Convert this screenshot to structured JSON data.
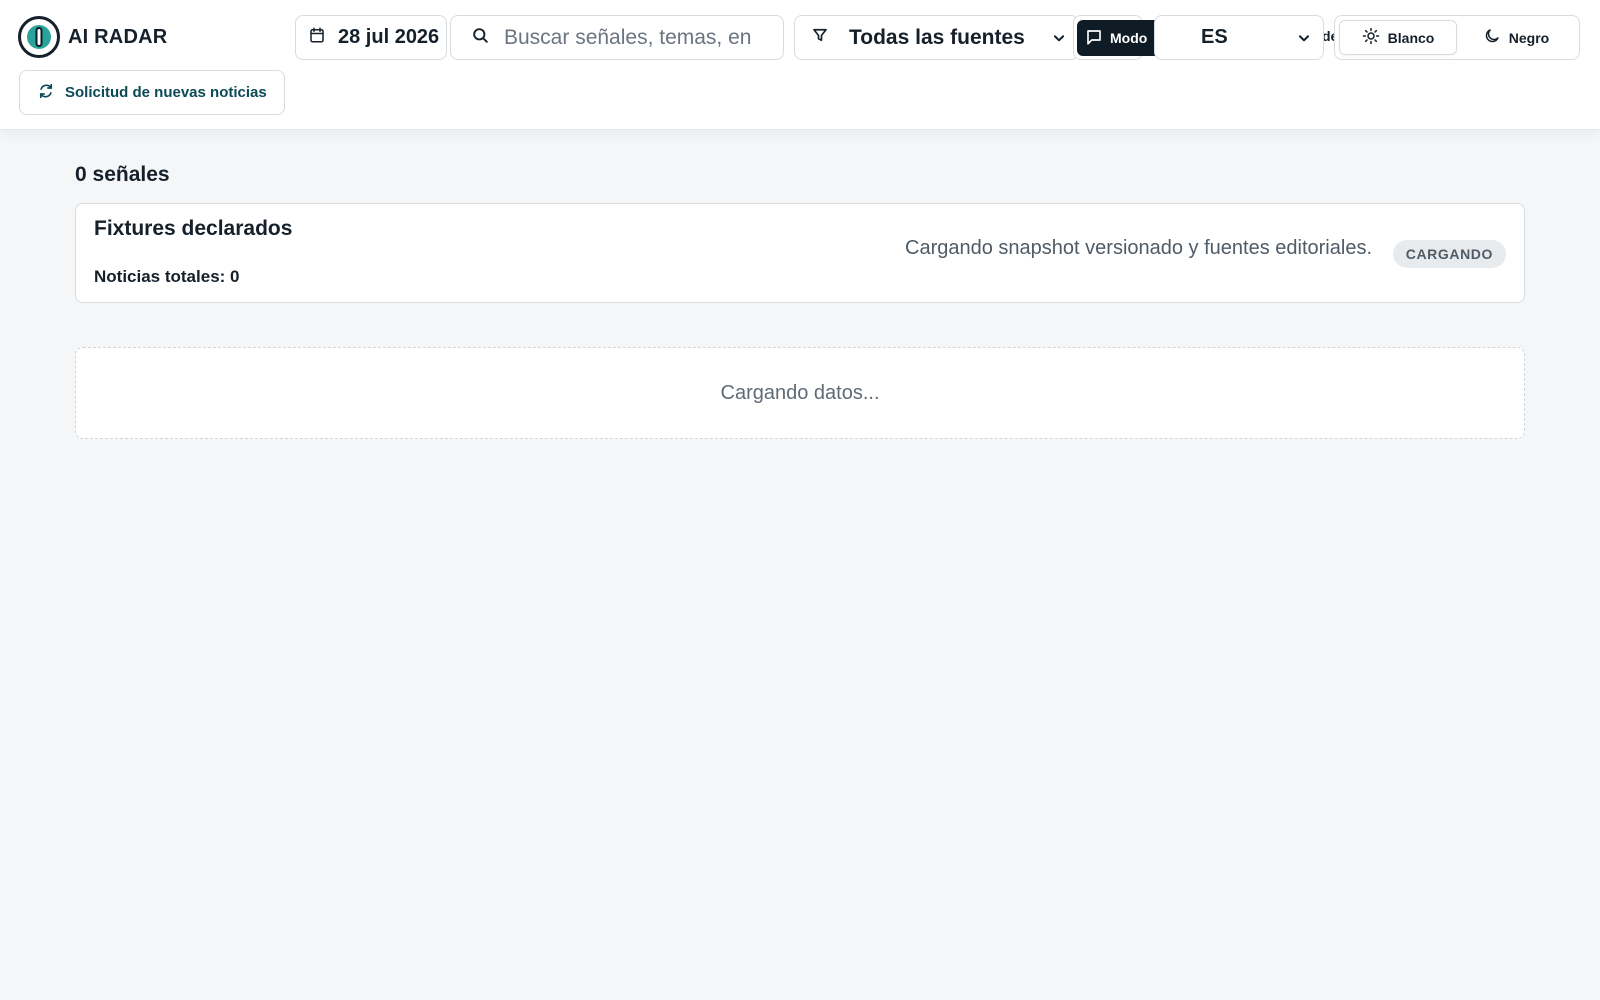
{
  "app": {
    "title": "AI RADAR"
  },
  "header": {
    "date": "28 jul 2026",
    "search": {
      "value": "",
      "placeholder": "Buscar señales, temas, en"
    },
    "source_filter": {
      "selected": "Todas las fuentes"
    },
    "mode_label": "Modo",
    "language": {
      "selected": "ES",
      "overflow_text": "de"
    },
    "theme": {
      "light_label": "Blanco",
      "dark_label": "Negro",
      "active": "Blanco"
    },
    "refresh_label": "Solicitud de nuevas noticias"
  },
  "main": {
    "signal_count": "0 señales",
    "card": {
      "title": "Fixtures declarados",
      "total": "Noticias totales: 0",
      "status_text": "Cargando snapshot versionado y fuentes editoriales.",
      "badge": "CARGANDO"
    },
    "loading_text": "Cargando datos..."
  },
  "icons": {
    "logo": "radar-logo-icon",
    "date": "calendar-icon",
    "search": "search-icon",
    "filter": "filter-icon",
    "chevron": "chevron-down-icon",
    "mode": "chat-bubble-icon",
    "light": "sun-icon",
    "dark": "moon-icon",
    "refresh": "refresh-icon"
  },
  "colors": {
    "brand_teal": "#0b4a56",
    "logo_teal": "#2aa39a",
    "dark_button": "#0f1c26",
    "page_background": "#f4f6f8",
    "badge_background": "#e8ebee"
  }
}
